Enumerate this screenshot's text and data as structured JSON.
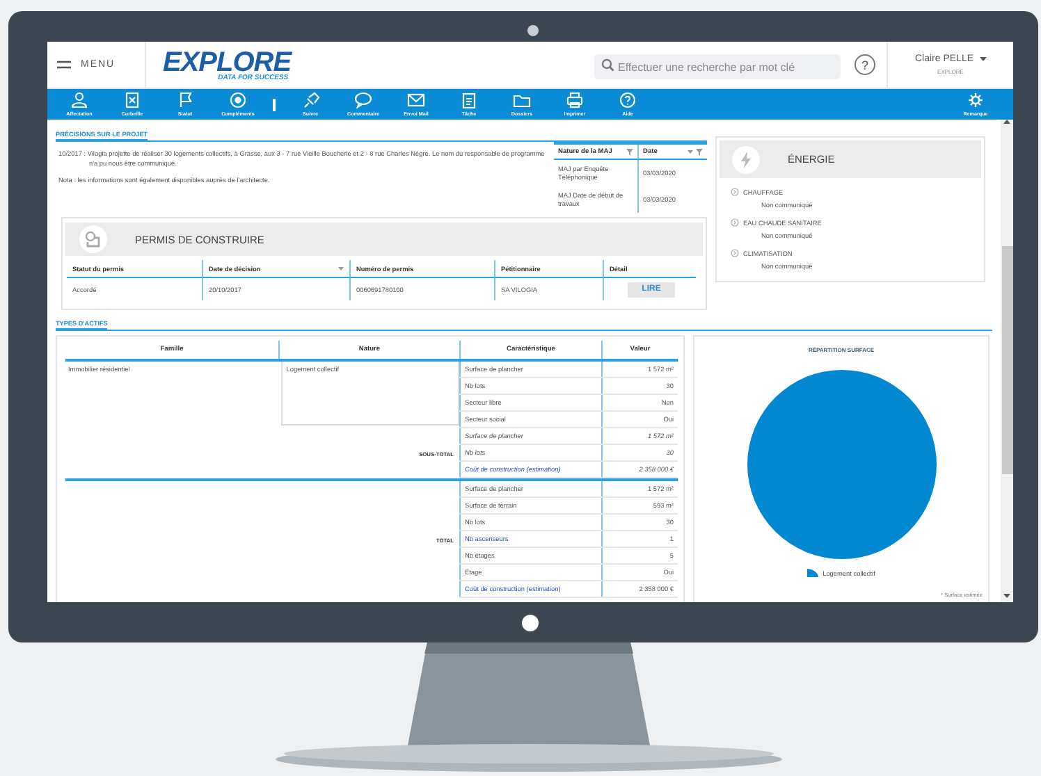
{
  "header": {
    "menu_label": "MENU",
    "logo": "EXPLORE",
    "tagline": "DATA FOR SUCCESS",
    "search": {
      "placeholder": "Effectuer une recherche par mot clé"
    },
    "help_button": "?",
    "user": {
      "name": "Claire PELLE",
      "organisation": "EXPLORE"
    }
  },
  "toolbar": {
    "items": [
      {
        "kind": "button",
        "label": "Affectation"
      },
      {
        "kind": "button",
        "label": "Corbeille"
      },
      {
        "kind": "button",
        "label": "Statut"
      },
      {
        "kind": "button",
        "label": "Compléments"
      },
      {
        "kind": "separator"
      },
      {
        "kind": "button",
        "label": "Suivre"
      },
      {
        "kind": "button",
        "label": "Commentaire"
      },
      {
        "kind": "button",
        "label": "Envoi Mail"
      },
      {
        "kind": "button",
        "label": "Tâche"
      },
      {
        "kind": "button",
        "label": "Dossiers"
      },
      {
        "kind": "button",
        "label": "Imprimer"
      },
      {
        "kind": "button",
        "label": "Aide"
      }
    ],
    "right_item": "Remarque"
  },
  "project": {
    "title": "PRÉCISIONS SUR LE PROJET",
    "paragraphs": [
      "10/2017 : Vilogia projette de réaliser 30 logements collectifs, à Grasse, aux 3 - 7 rue Vieille Boucherie et 2 - 8 rue Charles Nègre. Le nom du responsable de programme n'a pu nous être communiqué.",
      "Nota : les informations sont également disponibles auprès de l'architecte."
    ],
    "updates": {
      "columns": [
        "Nature de la MAJ",
        "Date"
      ],
      "rows": [
        [
          "MAJ par Enquête Téléphonique",
          "03/03/2020"
        ],
        [
          "MAJ Date de début de travaux",
          "03/03/2020"
        ]
      ]
    }
  },
  "permit": {
    "title": "PERMIS DE CONSTRUIRE",
    "columns": [
      "Statut du permis",
      "Date de décision",
      "Numéro de permis",
      "Pétitionnaire",
      "Détail"
    ],
    "rows": [
      {
        "status": "Accordé",
        "date": "20/10/2017",
        "number": "0060691780100",
        "applicant": "SA VILOGIA",
        "action": "LIRE"
      }
    ]
  },
  "energy": {
    "title": "ÉNERGIE",
    "items": [
      {
        "label": "CHAUFFAGE",
        "value": "Non communiqué"
      },
      {
        "label": "EAU CHAUDE SANITAIRE",
        "value": "Non communiqué"
      },
      {
        "label": "CLIMATISATION",
        "value": "Non communiqué"
      }
    ]
  },
  "assets": {
    "title": "TYPES D'ACTIFS",
    "columns": [
      "Famille",
      "Nature",
      "Caractéristique",
      "Valeur"
    ],
    "groups": [
      {
        "famille": "Immobilier résidentiel",
        "nature": "Logement collectif",
        "rows": [
          {
            "kind": "plain",
            "name": "Surface de plancher",
            "value": "1 572 m²"
          },
          {
            "kind": "plain",
            "name": "Nb lots",
            "value": "30"
          },
          {
            "kind": "plain",
            "name": "Secteur libre",
            "value": "Non"
          },
          {
            "kind": "plain",
            "name": "Secteur social",
            "value": "Oui"
          }
        ]
      },
      {
        "label": "SOUS-TOTAL",
        "rows": [
          {
            "kind": "italic",
            "name": "Surface de plancher",
            "value": "1 572 m²"
          },
          {
            "kind": "italic",
            "name": "Nb lots",
            "value": "30"
          },
          {
            "kind": "italic_link",
            "name": "Coût de construction (estimation)",
            "value": "2 358 000 €"
          }
        ]
      },
      {
        "label": "TOTAL",
        "rows": [
          {
            "kind": "plain",
            "name": "Surface de plancher",
            "value": "1 572 m²"
          },
          {
            "kind": "plain",
            "name": "Surface de terrain",
            "value": "593 m²"
          },
          {
            "kind": "plain",
            "name": "Nb lots",
            "value": "30"
          },
          {
            "kind": "link",
            "name": "Nb ascenseurs",
            "value": "1"
          },
          {
            "kind": "plain",
            "name": "Nb étages",
            "value": "5"
          },
          {
            "kind": "plain",
            "name": "Etage",
            "value": "Oui"
          },
          {
            "kind": "link",
            "name": "Coût de construction (estimation)",
            "value": "2 358 000 €"
          }
        ]
      }
    ]
  },
  "chart": {
    "chart_data": {
      "type": "pie",
      "title": "RÉPARTITION SURFACE",
      "categories": [
        "Logement collectif"
      ],
      "values": [
        100
      ]
    },
    "footnote": "* Surface estimée"
  }
}
